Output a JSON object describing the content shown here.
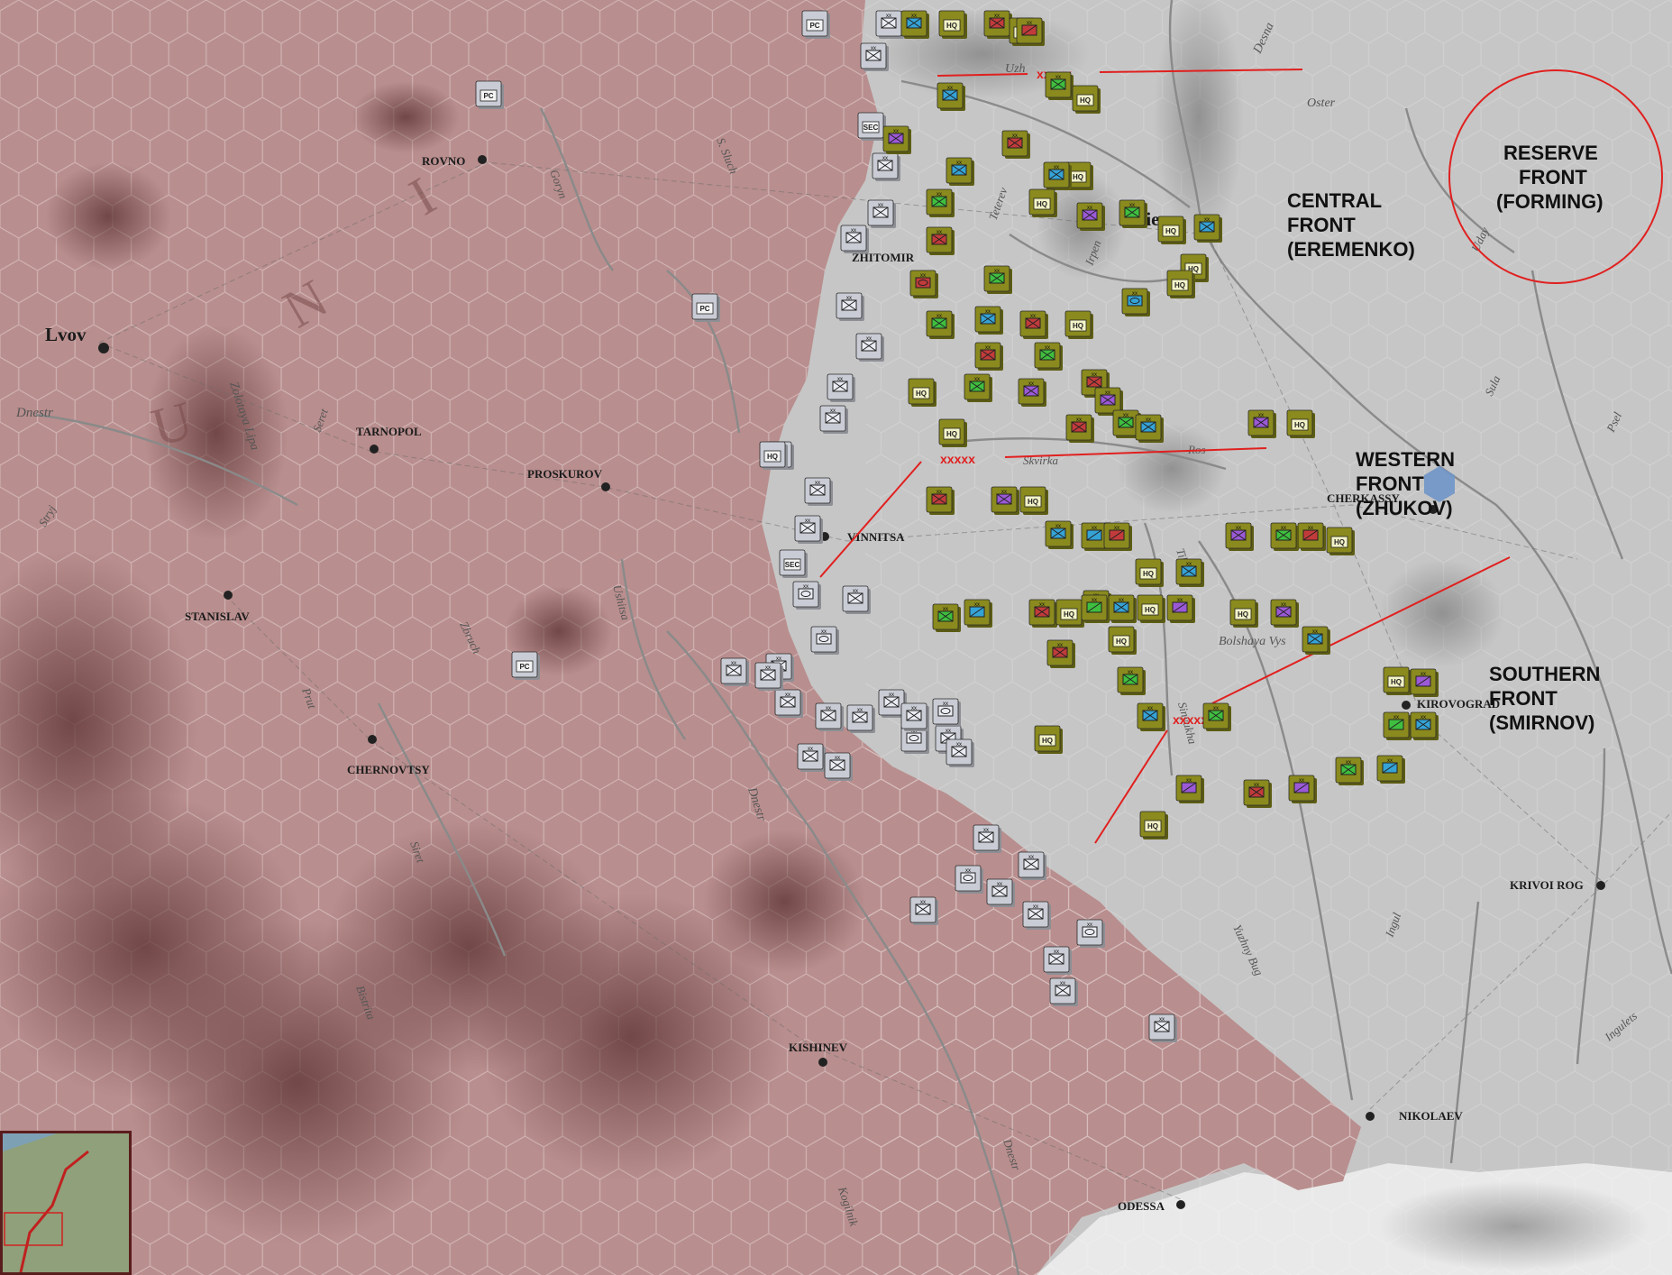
{
  "cities": [
    {
      "name": "Lvov",
      "key": "lvov"
    },
    {
      "name": "ROVNO",
      "key": "rovno"
    },
    {
      "name": "TARNOPOL",
      "key": "tarnopol"
    },
    {
      "name": "PROSKUROV",
      "key": "proskurov"
    },
    {
      "name": "STANISLAV",
      "key": "stanislav"
    },
    {
      "name": "CHERNOVTSY",
      "key": "chernovtsy"
    },
    {
      "name": "VINNITSA",
      "key": "vinnitsa"
    },
    {
      "name": "ZHITOMIR",
      "key": "zhitomir"
    },
    {
      "name": "Kiev",
      "key": "kiev"
    },
    {
      "name": "CHERKASSY",
      "key": "cherkassy"
    },
    {
      "name": "KIROVOGRAD",
      "key": "kirovograd"
    },
    {
      "name": "KRIVOI ROG",
      "key": "krivoi-rog"
    },
    {
      "name": "KISHINEV",
      "key": "kishinev"
    },
    {
      "name": "NIKOLAEV",
      "key": "nikolaev"
    },
    {
      "name": "ODESSA",
      "key": "odessa"
    }
  ],
  "rivers": [
    "Dnestr",
    "Uzh",
    "Oster",
    "Desna",
    "Goryn",
    "S. Sluch",
    "Teterev",
    "Irpen",
    "Uday",
    "Sula",
    "Psel",
    "Zolotaya Lipa",
    "Seret",
    "Stryj",
    "Zbruch",
    "Ushitsa",
    "Prut",
    "Siret",
    "Bistrita",
    "Skvirka",
    "Ros",
    "Tikich",
    "Bolshaya Vys",
    "Sinyukha",
    "Ingul",
    "Ingulets",
    "Yuzhny Bug",
    "Kogilnik",
    "Dnestr",
    "Dnestr"
  ],
  "region_letters": [
    "U",
    "N",
    "I"
  ],
  "fronts": [
    {
      "key": "reserve",
      "lines": [
        "RESERVE",
        "FRONT",
        "(FORMING)"
      ]
    },
    {
      "key": "central",
      "lines": [
        "CENTRAL",
        "FRONT",
        "(EREMENKO)"
      ]
    },
    {
      "key": "western",
      "lines": [
        "WESTERN",
        "FRONT",
        "(ZHUKOV)"
      ]
    },
    {
      "key": "southern",
      "lines": [
        "SOUTHERN",
        "FRONT",
        "(SMIRNOV)"
      ]
    }
  ],
  "army_boundary_mark": "xxxxx",
  "colors": {
    "axis_zone": "#b98e8e",
    "soviet_zone": "#c8c8c8",
    "boundary_line": "#e0201f",
    "soviet_counter_bg": "#8a8a1e",
    "axis_counter_bg": "#c9ccd4"
  },
  "counter_labels": {
    "hq": "HQ",
    "sec": "SEC",
    "pc": "PC"
  },
  "counters": {
    "axis": [
      [
        "inf",
        "PC"
      ],
      [
        "inf",
        "PC"
      ],
      [
        "inf",
        "PC"
      ],
      [
        "inf",
        "PC"
      ],
      [
        "inf",
        ""
      ],
      [
        "inf",
        ""
      ],
      [
        "inf",
        "SEC"
      ],
      [
        "inf",
        ""
      ],
      [
        "inf",
        ""
      ],
      [
        "inf",
        ""
      ],
      [
        "inf",
        ""
      ],
      [
        "inf",
        ""
      ],
      [
        "inf",
        ""
      ],
      [
        "inf",
        ""
      ],
      [
        "inf",
        ""
      ],
      [
        "inf",
        ""
      ],
      [
        "inf",
        "HQ"
      ],
      [
        "inf",
        ""
      ],
      [
        "inf",
        "SEC"
      ],
      [
        "arm",
        ""
      ],
      [
        "arm",
        ""
      ],
      [
        "inf",
        ""
      ],
      [
        "inf",
        ""
      ],
      [
        "inf",
        ""
      ],
      [
        "inf",
        ""
      ],
      [
        "arm",
        ""
      ],
      [
        "inf",
        ""
      ],
      [
        "inf",
        ""
      ],
      [
        "inf",
        ""
      ],
      [
        "inf",
        ""
      ],
      [
        "inf",
        ""
      ],
      [
        "inf",
        ""
      ],
      [
        "arm",
        ""
      ],
      [
        "inf",
        ""
      ],
      [
        "inf",
        ""
      ],
      [
        "inf",
        ""
      ],
      [
        "inf",
        ""
      ],
      [
        "inf",
        ""
      ],
      [
        "arm",
        ""
      ],
      [
        "inf",
        ""
      ],
      [
        "inf",
        ""
      ],
      [
        "inf",
        ""
      ],
      [
        "arm",
        ""
      ],
      [
        "inf",
        ""
      ],
      [
        "inf",
        ""
      ],
      [
        "inf",
        ""
      ]
    ],
    "soviet": [
      [
        "inf",
        "HQ"
      ],
      [
        "inf",
        ""
      ],
      [
        "inf",
        ""
      ],
      [
        "arm",
        "HQ"
      ],
      [
        "inf",
        ""
      ],
      [
        "inf",
        ""
      ],
      [
        "cav",
        ""
      ],
      [
        "inf",
        ""
      ],
      [
        "inf",
        "HQ"
      ],
      [
        "inf",
        ""
      ],
      [
        "inf",
        ""
      ],
      [
        "cav",
        "HQ"
      ],
      [
        "inf",
        ""
      ],
      [
        "inf",
        ""
      ],
      [
        "inf",
        "HQ"
      ],
      [
        "inf",
        ""
      ],
      [
        "inf",
        ""
      ],
      [
        "inf",
        "HQ"
      ],
      [
        "inf",
        ""
      ],
      [
        "inf",
        "HQ"
      ],
      [
        "inf",
        ""
      ],
      [
        "inf",
        ""
      ],
      [
        "arm",
        ""
      ],
      [
        "inf",
        "HQ"
      ],
      [
        "inf",
        ""
      ],
      [
        "inf",
        ""
      ],
      [
        "inf",
        ""
      ],
      [
        "inf",
        "HQ"
      ],
      [
        "inf",
        ""
      ],
      [
        "arm",
        ""
      ],
      [
        "inf",
        ""
      ],
      [
        "inf",
        ""
      ],
      [
        "inf",
        ""
      ],
      [
        "inf",
        "HQ"
      ],
      [
        "inf",
        ""
      ],
      [
        "inf",
        ""
      ],
      [
        "inf",
        ""
      ],
      [
        "inf",
        "HQ"
      ],
      [
        "inf",
        ""
      ],
      [
        "inf",
        ""
      ],
      [
        "cav",
        "HQ"
      ],
      [
        "inf",
        ""
      ],
      [
        "inf",
        ""
      ],
      [
        "inf",
        ""
      ],
      [
        "inf",
        "HQ"
      ],
      [
        "cav",
        ""
      ],
      [
        "cav",
        ""
      ],
      [
        "inf",
        ""
      ],
      [
        "inf",
        "HQ"
      ],
      [
        "inf",
        ""
      ],
      [
        "cav",
        ""
      ],
      [
        "cav",
        "HQ"
      ],
      [
        "inf",
        ""
      ],
      [
        "inf",
        ""
      ],
      [
        "inf",
        "HQ"
      ],
      [
        "cav",
        ""
      ],
      [
        "inf",
        ""
      ],
      [
        "inf",
        ""
      ],
      [
        "cav",
        "HQ"
      ],
      [
        "inf",
        ""
      ],
      [
        "inf",
        ""
      ],
      [
        "cav",
        ""
      ],
      [
        "inf",
        ""
      ],
      [
        "inf",
        "HQ"
      ],
      [
        "cav",
        ""
      ],
      [
        "inf",
        ""
      ],
      [
        "inf",
        ""
      ],
      [
        "cav",
        "HQ"
      ],
      [
        "inf",
        ""
      ],
      [
        "inf",
        ""
      ],
      [
        "inf",
        "HQ"
      ],
      [
        "cav",
        ""
      ],
      [
        "cav",
        ""
      ],
      [
        "inf",
        ""
      ],
      [
        "inf",
        "HQ"
      ],
      [
        "cav",
        ""
      ],
      [
        "inf",
        ""
      ],
      [
        "inf",
        "HQ"
      ],
      [
        "inf",
        ""
      ],
      [
        "cav",
        ""
      ],
      [
        "inf",
        ""
      ],
      [
        "cav",
        ""
      ],
      [
        "inf",
        "HQ"
      ],
      [
        "inf",
        ""
      ]
    ]
  }
}
